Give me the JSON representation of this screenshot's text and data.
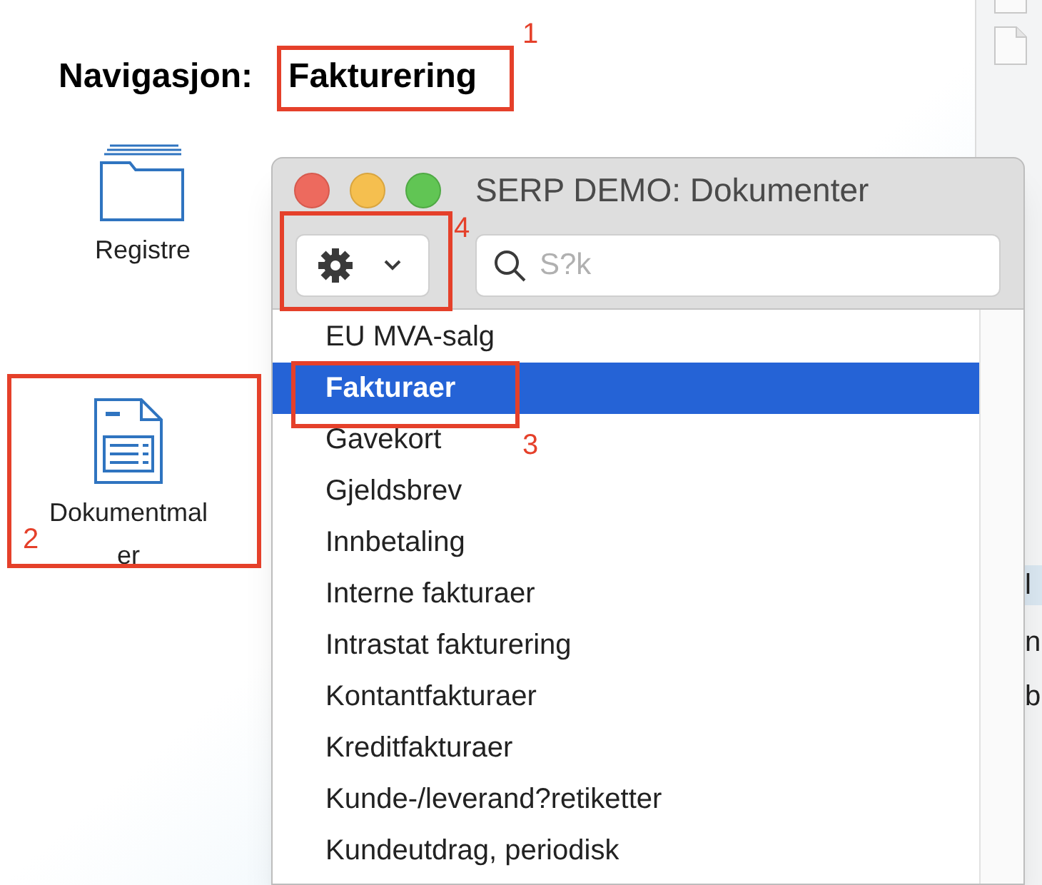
{
  "navigation": {
    "label": "Navigasjon:",
    "value": "Fakturering"
  },
  "desktop_icons": [
    {
      "kind": "folder",
      "label": "Registre"
    },
    {
      "kind": "document",
      "label": "Dokumentmaler"
    }
  ],
  "dialog": {
    "title": "SERP DEMO: Dokumenter",
    "search": {
      "placeholder": "S?k"
    },
    "items": [
      {
        "label": "EU MVA-salg",
        "selected": false
      },
      {
        "label": "Fakturaer",
        "selected": true
      },
      {
        "label": "Gavekort",
        "selected": false
      },
      {
        "label": "Gjeldsbrev",
        "selected": false
      },
      {
        "label": "Innbetaling",
        "selected": false
      },
      {
        "label": "Interne fakturaer",
        "selected": false
      },
      {
        "label": "Intrastat fakturering",
        "selected": false
      },
      {
        "label": "Kontantfakturaer",
        "selected": false
      },
      {
        "label": "Kreditfakturaer",
        "selected": false
      },
      {
        "label": "Kunde-/leverand?retiketter",
        "selected": false
      },
      {
        "label": "Kundeutdrag, periodisk",
        "selected": false
      }
    ]
  },
  "background_fragments": [
    "l",
    "n",
    "b"
  ],
  "annotations": [
    {
      "label": "1"
    },
    {
      "label": "2"
    },
    {
      "label": "3"
    },
    {
      "label": "4"
    }
  ]
}
